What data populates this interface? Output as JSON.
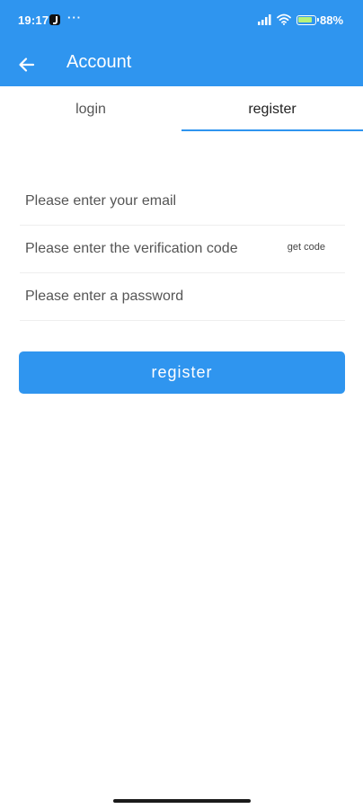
{
  "status_bar": {
    "time": "19:17",
    "more": "···",
    "battery_text": "88%"
  },
  "app_bar": {
    "title": "Account"
  },
  "tabs": [
    {
      "label": "login",
      "active": false
    },
    {
      "label": "register",
      "active": true
    }
  ],
  "form": {
    "email_placeholder": "Please enter your email",
    "email_value": "",
    "code_placeholder": "Please enter the verification code",
    "code_value": "",
    "get_code_label": "get code",
    "password_placeholder": "Please enter a password",
    "password_value": ""
  },
  "register_button_label": "register",
  "colors": {
    "primary": "#2f95ef",
    "text": "#555555",
    "divider": "#eeeeee"
  },
  "icons": {
    "back": "arrow-left-icon",
    "signal": "signal-icon",
    "wifi": "wifi-icon",
    "battery": "battery-icon"
  }
}
